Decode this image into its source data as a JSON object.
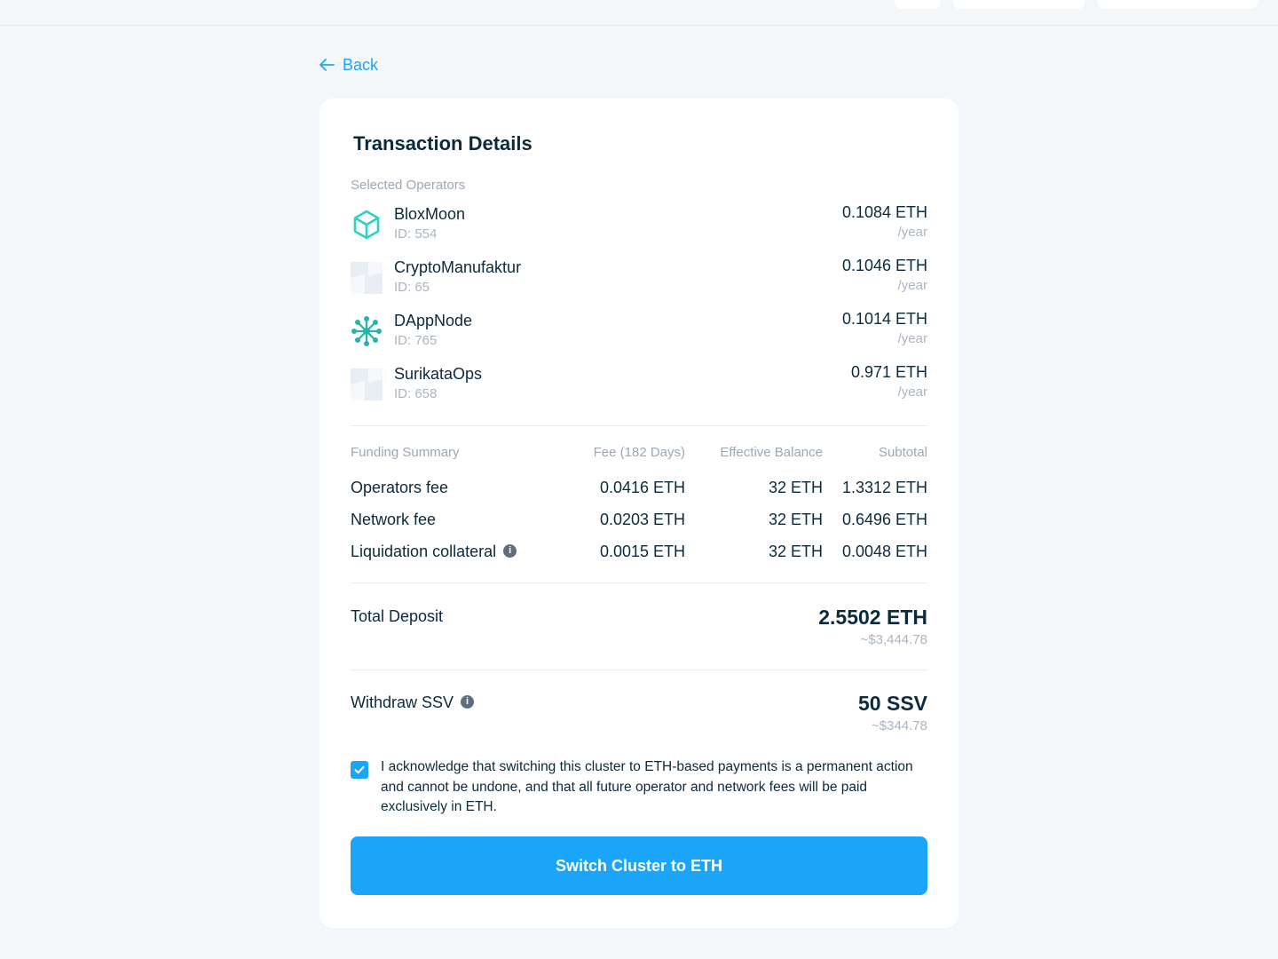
{
  "nav": {
    "back_label": "Back"
  },
  "card": {
    "title": "Transaction Details",
    "operators_label": "Selected Operators",
    "operators": [
      {
        "name": "BloxMoon",
        "id": "ID: 554",
        "fee": "0.1084 ETH",
        "period": "/year",
        "logo": "cube-logo-icon"
      },
      {
        "name": "CryptoManufaktur",
        "id": "ID: 65",
        "fee": "0.1046 ETH",
        "period": "/year",
        "logo": "placeholder-logo-icon"
      },
      {
        "name": "DAppNode",
        "id": "ID: 765",
        "fee": "0.1014 ETH",
        "period": "/year",
        "logo": "network-logo-icon"
      },
      {
        "name": "SurikataOps",
        "id": "ID: 658",
        "fee": "0.971 ETH",
        "period": "/year",
        "logo": "placeholder-logo-icon"
      }
    ],
    "funding": {
      "headers": [
        "Funding Summary",
        "Fee (182 Days)",
        "Effective Balance",
        "Subtotal"
      ],
      "rows": [
        {
          "label": "Operators fee",
          "fee": "0.0416 ETH",
          "balance": "32 ETH",
          "subtotal": "1.3312 ETH"
        },
        {
          "label": "Network fee",
          "fee": "0.0203 ETH",
          "balance": "32 ETH",
          "subtotal": "0.6496 ETH"
        },
        {
          "label": "Liquidation collateral",
          "fee": "0.0015 ETH",
          "balance": "32 ETH",
          "subtotal": "0.0048 ETH"
        }
      ]
    },
    "total": {
      "label": "Total Deposit",
      "value": "2.5502 ETH",
      "usd": "~$3,444.78"
    },
    "withdraw": {
      "label": "Withdraw SSV",
      "value": "50 SSV",
      "usd": "~$344.78"
    },
    "acknowledge": {
      "checked": true,
      "text": "I acknowledge that switching this cluster to ETH-based payments is a permanent action and cannot be undone, and that all future operator and network fees will be paid exclusively in ETH."
    },
    "cta_label": "Switch Cluster to ETH"
  },
  "colors": {
    "accent": "#1ba5f8",
    "text": "#0b2a3c",
    "muted": "#9aa8b8",
    "background": "#f4f7fa"
  }
}
